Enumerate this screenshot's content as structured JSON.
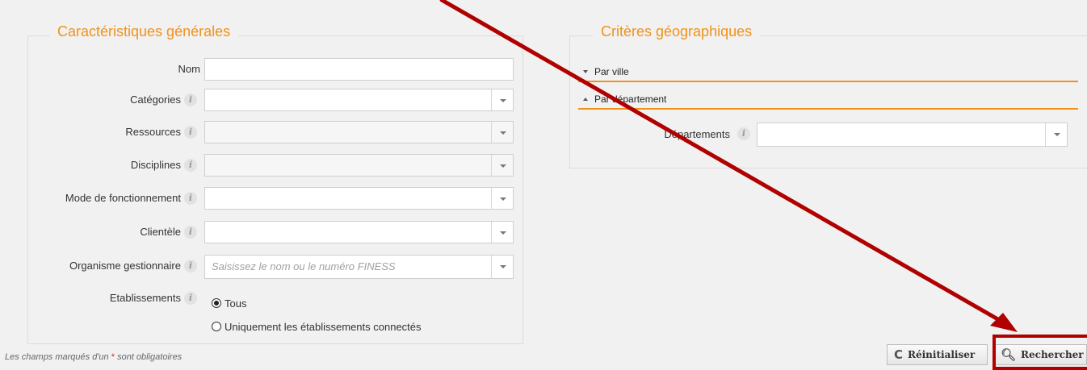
{
  "general": {
    "legend": "Caractéristiques générales",
    "fields": {
      "nom": "Nom",
      "categories": "Catégories",
      "ressources": "Ressources",
      "disciplines": "Disciplines",
      "mode": "Mode de fonctionnement",
      "clientele": "Clientèle",
      "organisme": "Organisme gestionnaire",
      "organisme_placeholder": "Saisissez le nom ou le numéro FINESS",
      "etablissements": "Etablissements"
    },
    "info_glyph": "i",
    "radio_options": [
      "Tous",
      "Uniquement les établissements connectés"
    ],
    "radio_selected": "Tous"
  },
  "geo": {
    "legend": "Critères géographiques",
    "sections": [
      "Par ville",
      "Par département"
    ],
    "departements_label": "Départements"
  },
  "footer": {
    "note_prefix": "Les champs marqués d'un",
    "star": "*",
    "note_suffix": "sont obligatoires"
  },
  "buttons": {
    "reset": "Réinitialiser",
    "search": "Rechercher"
  },
  "colors": {
    "accent": "#f0921a",
    "annotation": "#b00000"
  }
}
